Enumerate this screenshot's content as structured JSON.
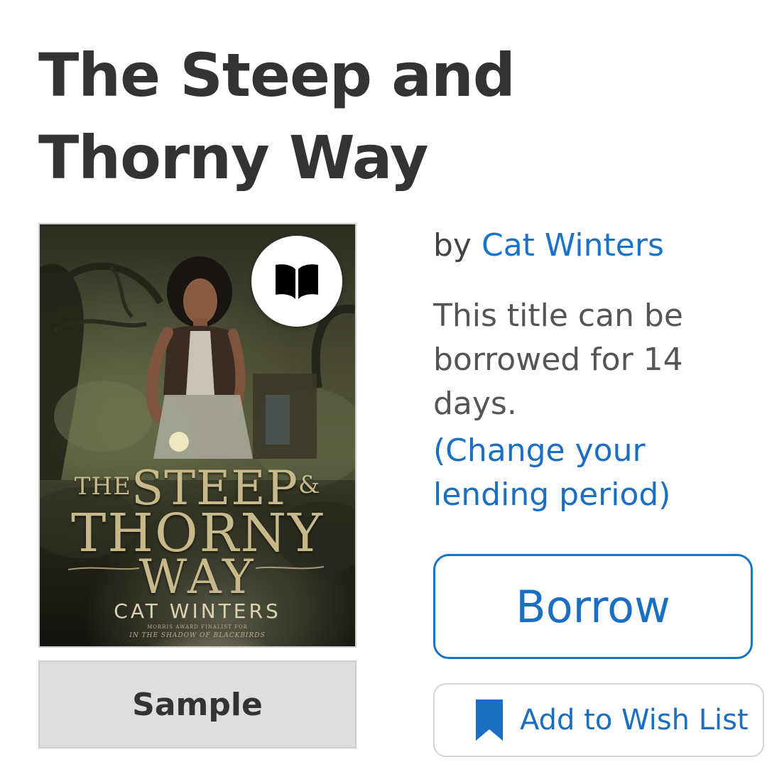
{
  "book": {
    "title": "The Steep and Thorny Way",
    "by_prefix": "by ",
    "author": "Cat Winters",
    "lending_text": "This title can be borrowed for 14 days.",
    "lending_link": "(Change your lending period)"
  },
  "cover": {
    "title_the": "THE",
    "title_steep": "STEEP",
    "title_amp": "&",
    "title_thorny": "THORNY",
    "title_way": "WAY",
    "author": "CAT WINTERS",
    "note_line1": "MORRIS AWARD FINALIST FOR",
    "note_line2": "IN THE SHADOW OF BLACKBIRDS",
    "format_icon": "open-book-icon"
  },
  "actions": {
    "sample_label": "Sample",
    "borrow_label": "Borrow",
    "wishlist_label": "Add to Wish List",
    "wishlist_icon": "bookmark-icon"
  },
  "colors": {
    "accent": "#1a73c8",
    "title_text": "#333333",
    "body_text": "#555555",
    "sample_bg": "#dedede"
  }
}
